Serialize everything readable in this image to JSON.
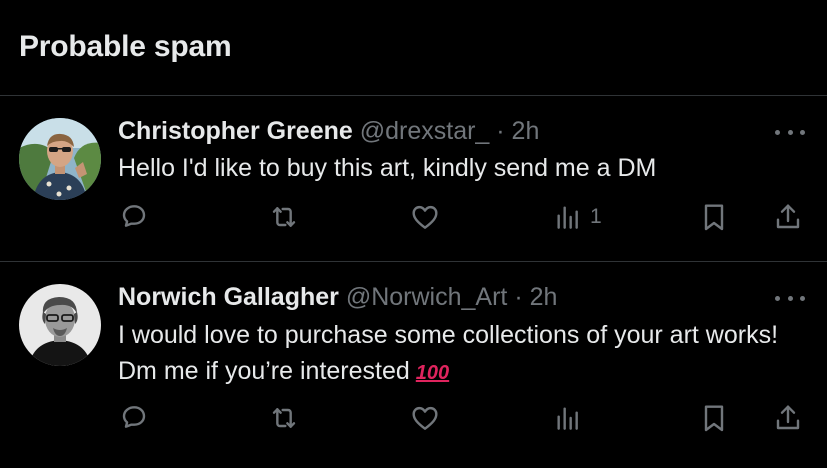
{
  "section": {
    "title": "Probable spam"
  },
  "tweets": [
    {
      "name": "Christopher Greene",
      "handle": "@drexstar_",
      "separator": " · ",
      "time": "2h",
      "text": "Hello I'd like to buy this art, kindly send me a DM",
      "emoji": "",
      "views": "1"
    },
    {
      "name": "Norwich Gallagher",
      "handle": "@Norwich_Art",
      "separator": " · ",
      "time": "2h",
      "text": "I would love to purchase some collections of your art works! Dm me if you’re interested",
      "emoji": "100",
      "views": ""
    }
  ],
  "icons": {
    "reply": "reply-icon",
    "retweet": "retweet-icon",
    "like": "heart-icon",
    "views": "analytics-icon",
    "bookmark": "bookmark-icon",
    "share": "share-icon",
    "more": "more-icon"
  },
  "colors": {
    "background": "#000000",
    "text": "#e7e9ea",
    "secondary": "#71767b",
    "divider": "#2f3336",
    "emoji": "#e0245e"
  }
}
